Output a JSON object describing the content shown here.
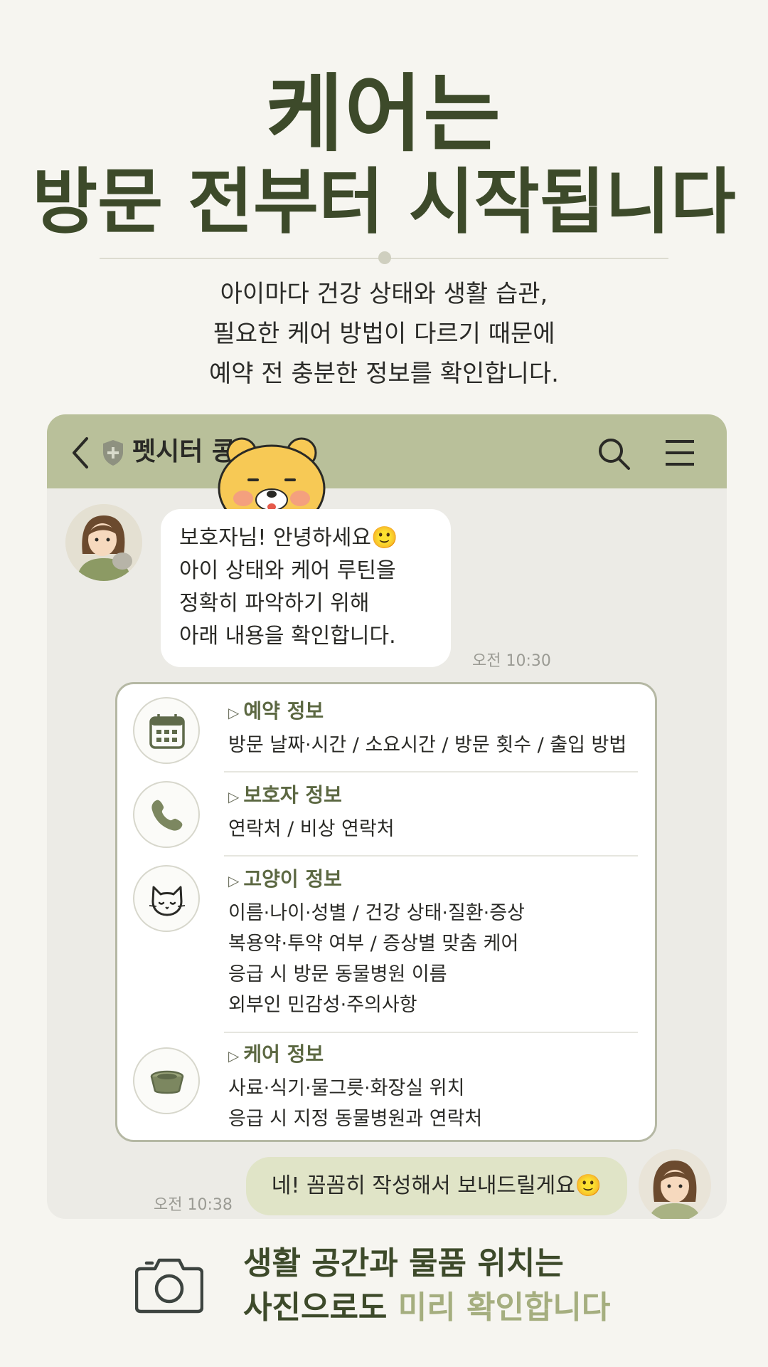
{
  "headline": {
    "line1": "케어는",
    "line2": "방문 전부터 시작됩니다"
  },
  "intro": [
    "아이마다 건강 상태와 생활 습관,",
    "필요한 케어 방법이 다르기 때문에",
    "예약 전 충분한 정보를 확인합니다."
  ],
  "chat": {
    "header": {
      "title": "펫시터 콩",
      "back_icon": "chevron-left-icon",
      "shield_icon": "shield-icon",
      "search_icon": "search-icon",
      "menu_icon": "menu-icon",
      "color": "#b9c09a"
    },
    "incoming": {
      "lines": [
        "보호자님! 안녕하세요🙂",
        "아이 상태와 케어 루틴을",
        "정확히 파악하기 위해",
        "아래 내용을 확인합니다."
      ],
      "time": "오전 10:30"
    },
    "info_card": {
      "sections": [
        {
          "title": "예약 정보",
          "icon": "calendar-icon",
          "lines": [
            "방문 날짜·시간 / 소요시간 / 방문 횟수 / 출입 방법"
          ]
        },
        {
          "title": "보호자 정보",
          "icon": "phone-icon",
          "lines": [
            "연락처 / 비상 연락처"
          ]
        },
        {
          "title": "고양이 정보",
          "icon": "cat-icon",
          "lines": [
            "이름·나이·성별 / 건강 상태·질환·증상",
            "복용약·투약 여부 / 증상별 맞춤 케어",
            "응급 시 방문 동물병원 이름",
            "외부인 민감성·주의사항"
          ]
        },
        {
          "title": "케어 정보",
          "icon": "pet-bowl-icon",
          "lines": [
            "사료·식기·물그릇·화장실 위치",
            "응급 시 지정 동물병원과 연락처"
          ]
        }
      ]
    },
    "outgoing": {
      "text": "네! 꼼꼼히 작성해서 보내드릴게요🙂",
      "time": "오전 10:38"
    }
  },
  "footer": {
    "line1": "생활 공간과 물품 위치는",
    "line2_prefix": "사진으로도 ",
    "line2_accent": "미리 확인합니다",
    "icon": "camera-icon",
    "accent_color": "#a5ae7f"
  }
}
